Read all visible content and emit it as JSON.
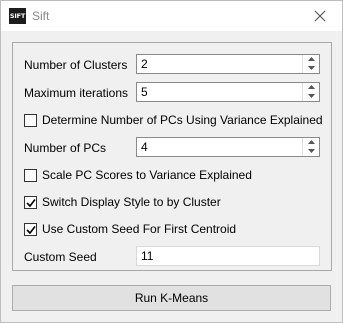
{
  "window": {
    "app_icon_text": "SIFT",
    "title": "Sift"
  },
  "form": {
    "num_clusters": {
      "label": "Number of Clusters",
      "value": "2"
    },
    "max_iterations": {
      "label": "Maximum iterations",
      "value": "5"
    },
    "determine_pcs_variance": {
      "label": "Determine Number of PCs Using Variance Explained",
      "checked": false
    },
    "num_pcs": {
      "label": "Number of PCs",
      "value": "4"
    },
    "scale_pc_scores": {
      "label": "Scale PC Scores to Variance Explained",
      "checked": false
    },
    "switch_display_style": {
      "label": "Switch Display Style to by Cluster",
      "checked": true
    },
    "custom_seed_centroid": {
      "label": "Use Custom Seed For First Centroid",
      "checked": true
    },
    "custom_seed": {
      "label": "Custom Seed",
      "value": "11"
    }
  },
  "run_button": {
    "label": "Run K-Means"
  }
}
